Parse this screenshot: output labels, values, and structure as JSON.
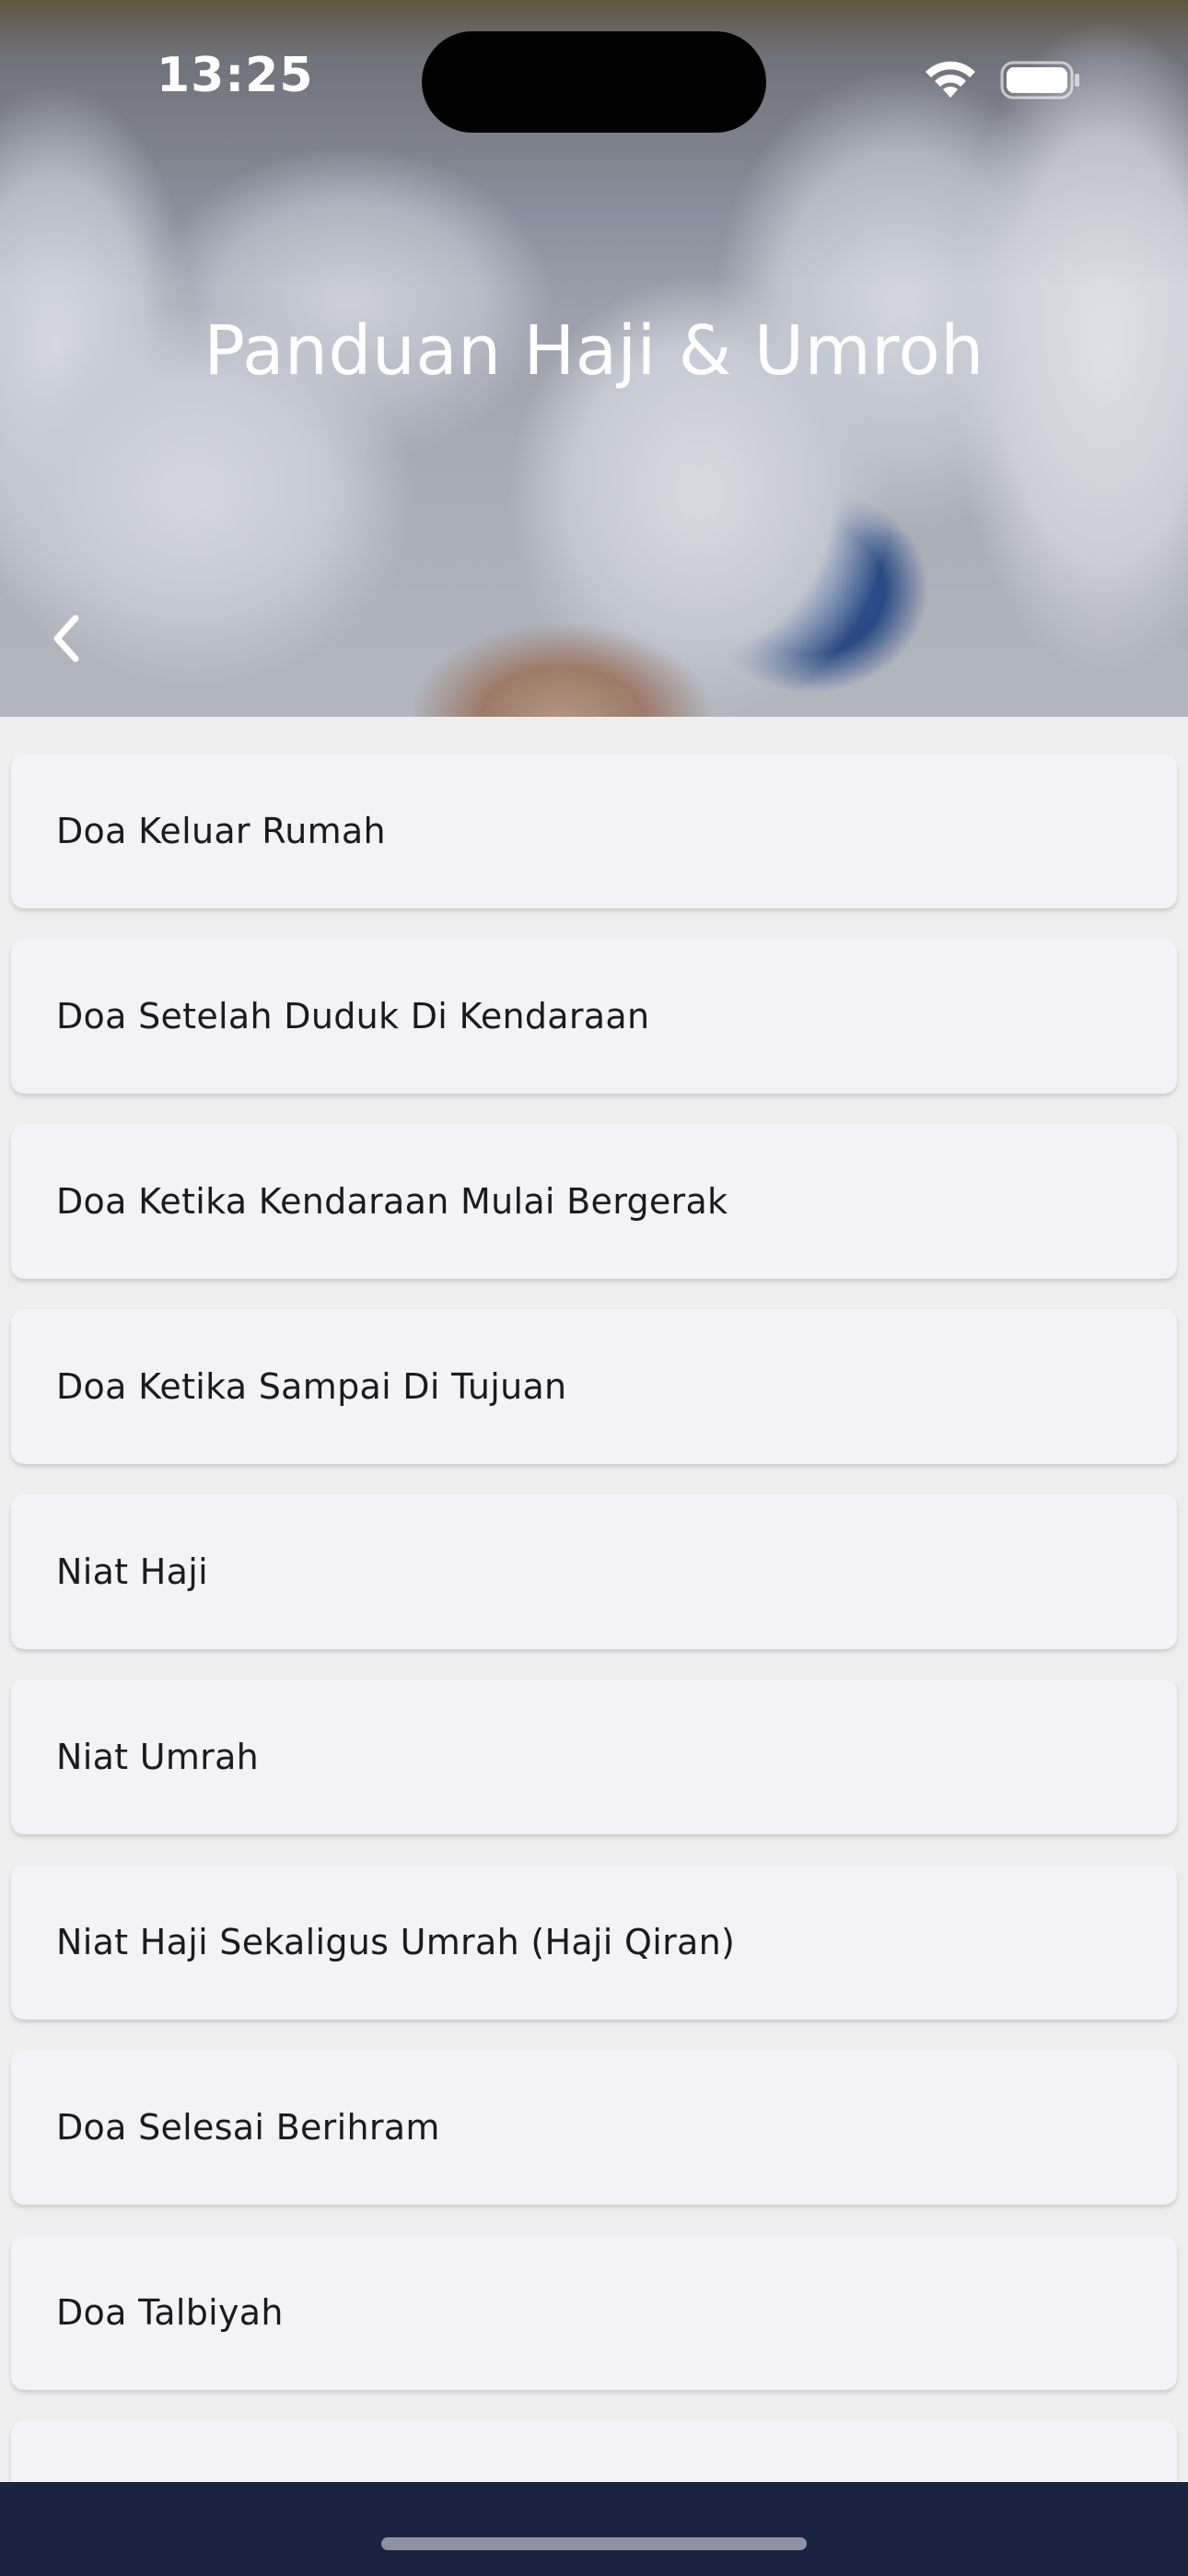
{
  "status_bar": {
    "time": "13:25",
    "icons": [
      "wifi-icon",
      "battery-icon"
    ]
  },
  "header": {
    "title": "Panduan Haji & Umroh",
    "back_icon": "chevron-left-icon"
  },
  "list": {
    "items": [
      {
        "label": "Doa Keluar Rumah"
      },
      {
        "label": "Doa Setelah Duduk Di Kendaraan"
      },
      {
        "label": "Doa Ketika Kendaraan Mulai Bergerak"
      },
      {
        "label": "Doa Ketika Sampai Di Tujuan"
      },
      {
        "label": "Niat Haji"
      },
      {
        "label": "Niat Umrah"
      },
      {
        "label": "Niat Haji Sekaligus Umrah (Haji Qiran)"
      },
      {
        "label": "Doa Selesai Berihram"
      },
      {
        "label": "Doa Talbiyah"
      },
      {
        "label": ""
      }
    ]
  },
  "colors": {
    "list_background": "#eeeeee",
    "card_background": "#f2f2f7",
    "bottom_bar": "#1a2440",
    "title_text": "#ffffff"
  }
}
